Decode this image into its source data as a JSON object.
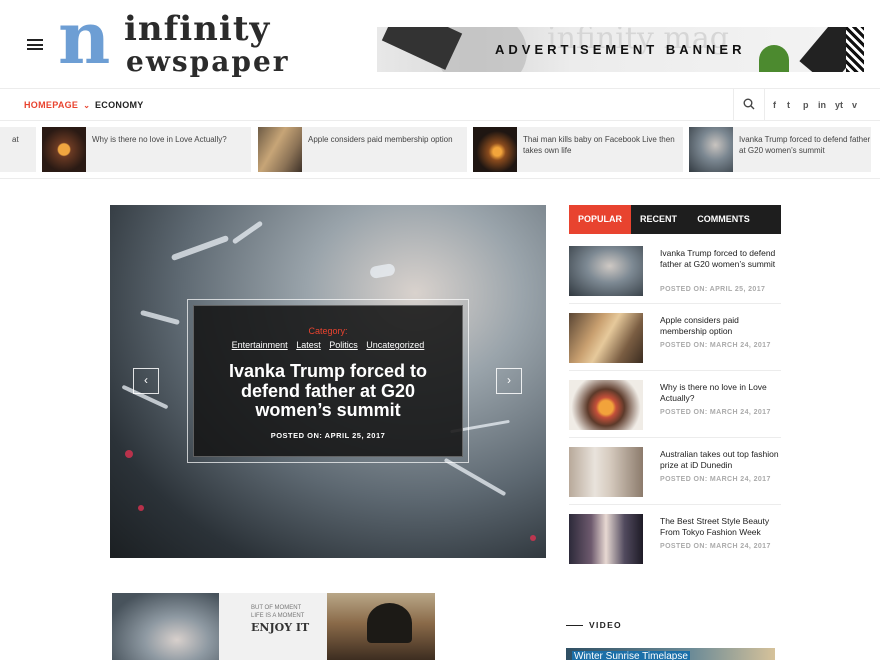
{
  "header": {
    "logo_initial": "n",
    "logo_line1": "infinity",
    "logo_line2": "ewspaper",
    "ad_text": "ADVERTISEMENT BANNER",
    "ad_bg_text": "infinity mag"
  },
  "nav": {
    "items": [
      {
        "label": "HOMEPAGE",
        "active": true
      },
      {
        "label": "ECONOMY",
        "active": false
      }
    ],
    "social": [
      "f",
      "t",
      "p",
      "in",
      "yt",
      "v"
    ]
  },
  "ticker": [
    {
      "title": "at"
    },
    {
      "title": "Why is there no love in Love Actually?"
    },
    {
      "title": "Apple considers paid membership option"
    },
    {
      "title": "Thai man kills baby on Facebook Live then takes own life"
    },
    {
      "title": "Ivanka Trump forced to defend father at G20 women’s summit"
    }
  ],
  "slider": {
    "category_label": "Category:",
    "tags": [
      "Entertainment",
      "Latest",
      "Politics",
      "Uncategorized"
    ],
    "title": "Ivanka Trump forced to defend father at G20 women’s summit",
    "date": "POSTED ON: APRIL 25, 2017",
    "prev": "‹",
    "next": "›"
  },
  "sidebar": {
    "tabs": [
      "POPULAR",
      "RECENT",
      "COMMENTS"
    ],
    "posts": [
      {
        "title": "Ivanka Trump forced to defend father at G20 women’s summit",
        "date": "POSTED ON: APRIL 25, 2017"
      },
      {
        "title": "Apple considers paid membership option",
        "date": "POSTED ON: MARCH 24, 2017"
      },
      {
        "title": "Why is there no love in Love Actually?",
        "date": "POSTED ON: MARCH 24, 2017"
      },
      {
        "title": "Australian takes out top fashion prize at iD Dunedin",
        "date": "POSTED ON: MARCH 24, 2017"
      },
      {
        "title": "The Best Street Style Beauty From Tokyo Fashion Week",
        "date": "POSTED ON: MARCH 24, 2017"
      }
    ],
    "video_heading": "VIDEO",
    "video_title": "Winter Sunrise Timelapse"
  },
  "bottom_images": {
    "note_line1": "BUT OF MOMENT",
    "note_line2": "LIFE IS A MOMENT",
    "note_line3": "ENJOY IT"
  },
  "colors": {
    "accent": "#e8432f",
    "dark": "#1e1e1e",
    "logo_blue": "#6d9ed4"
  }
}
